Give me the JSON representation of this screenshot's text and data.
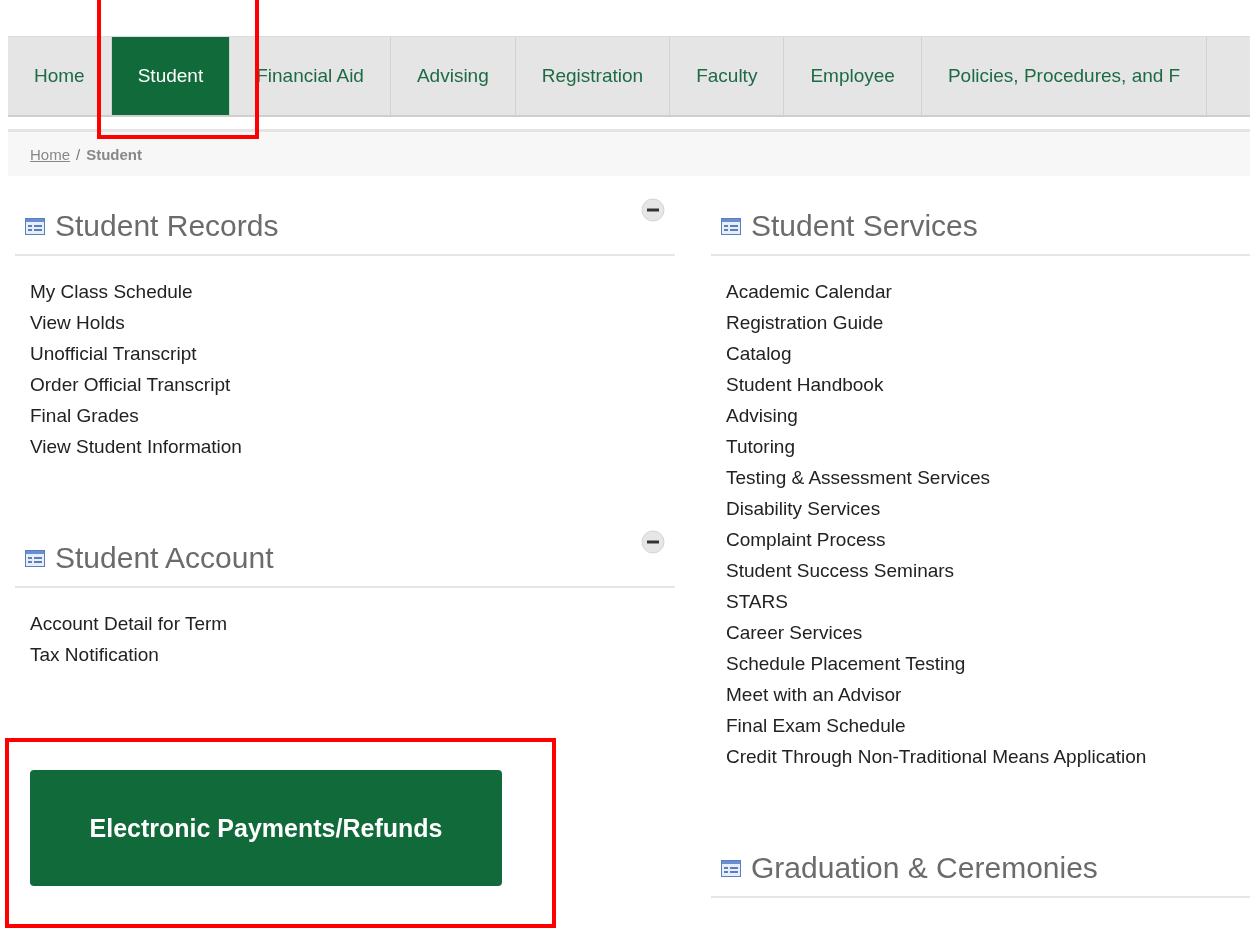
{
  "nav": {
    "tabs": [
      {
        "label": "Home",
        "selected": false
      },
      {
        "label": "Student",
        "selected": true
      },
      {
        "label": "Financial Aid",
        "selected": false
      },
      {
        "label": "Advising",
        "selected": false
      },
      {
        "label": "Registration",
        "selected": false
      },
      {
        "label": "Faculty",
        "selected": false
      },
      {
        "label": "Employee",
        "selected": false
      },
      {
        "label": "Policies, Procedures, and F",
        "selected": false
      }
    ]
  },
  "breadcrumb": {
    "items": [
      {
        "label": "Home",
        "kind": "link"
      },
      {
        "label": "/",
        "kind": "separator"
      },
      {
        "label": "Student",
        "kind": "current"
      }
    ]
  },
  "left_column": {
    "sections": [
      {
        "title": "Student Records",
        "collapsible": true,
        "links": [
          "My Class Schedule",
          "View Holds",
          "Unofficial Transcript",
          "Order Official Transcript",
          "Final Grades",
          "View Student Information"
        ]
      },
      {
        "title": "Student Account",
        "collapsible": true,
        "links": [
          "Account Detail for Term",
          "Tax Notification"
        ]
      }
    ],
    "button": "Electronic Payments/Refunds"
  },
  "right_column": {
    "sections": [
      {
        "title": "Student Services",
        "collapsible": false,
        "links": [
          "Academic Calendar",
          "Registration Guide",
          "Catalog",
          "Student Handbook",
          "Advising",
          "Tutoring",
          "Testing & Assessment Services",
          "Disability Services",
          "Complaint Process",
          "Student Success Seminars",
          "STARS",
          "Career Services",
          "Schedule Placement Testing",
          "Meet with an Advisor",
          "Final Exam Schedule",
          "Credit Through Non-Traditional Means Application"
        ]
      },
      {
        "title": "Graduation & Ceremonies",
        "collapsible": false
      }
    ]
  }
}
